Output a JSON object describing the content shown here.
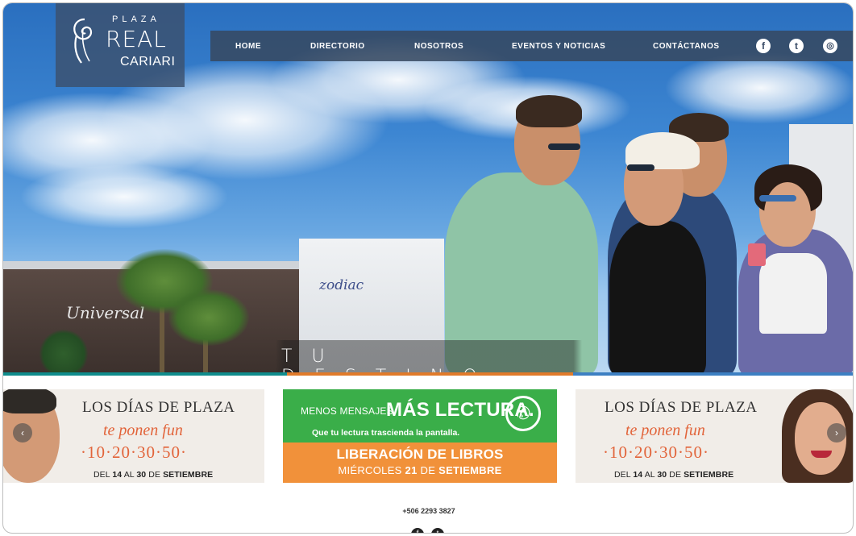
{
  "logo": {
    "line1": "PLAZA",
    "line2": "REAL",
    "line3": "CARIARI"
  },
  "nav": {
    "items": [
      "HOME",
      "DIRECTORIO",
      "NOSOTROS",
      "EVENTOS Y NOTICIAS",
      "CONTÁCTANOS"
    ],
    "social": {
      "facebook": "f",
      "twitter": "t",
      "instagram": "◎"
    }
  },
  "hero": {
    "tagline": "TU DESTINO",
    "signs": {
      "universal": "Universal",
      "zodiac": "zodiac"
    },
    "stripe_colors": [
      "#0f8c8c",
      "#e07a2a",
      "#3c7fc2"
    ]
  },
  "banners": {
    "left": {
      "title": "LOS DÍAS DE PLAZA",
      "fun": "te ponen fun",
      "numbers": "·10·20·30·50·",
      "dates_pre": "DEL ",
      "dates_from": "14",
      "dates_mid": " AL ",
      "dates_to": "30",
      "dates_post": " DE ",
      "dates_month": "SETIEMBRE"
    },
    "middle": {
      "line1": "MENOS MENSAJES.",
      "line2": "MÁS LECTURA.",
      "line3": "Que tu lectura trascienda la pantalla.",
      "whatsapp_icon": "whatsapp-icon",
      "title": "LIBERACIÓN DE LIBROS",
      "date_pre": "MIÉRCOLES ",
      "date_day": "21",
      "date_mid": " DE ",
      "date_month": "SETIEMBRE"
    },
    "right": {
      "title": "LOS DÍAS DE PLAZA",
      "fun": "te ponen fun",
      "numbers": "·10·20·30·50·",
      "dates_pre": "DEL ",
      "dates_from": "14",
      "dates_mid": " AL ",
      "dates_to": "30",
      "dates_post": " DE ",
      "dates_month": "SETIEMBRE"
    },
    "prev_arrow": "‹",
    "next_arrow": "›"
  },
  "footer": {
    "phone": "+506 2293 3827",
    "facebook": "f",
    "twitter": "t"
  },
  "colors": {
    "nav_bg": "#374860",
    "banner_green": "#3aae49",
    "banner_orange": "#f1913a",
    "accent_orange": "#e2643a"
  }
}
